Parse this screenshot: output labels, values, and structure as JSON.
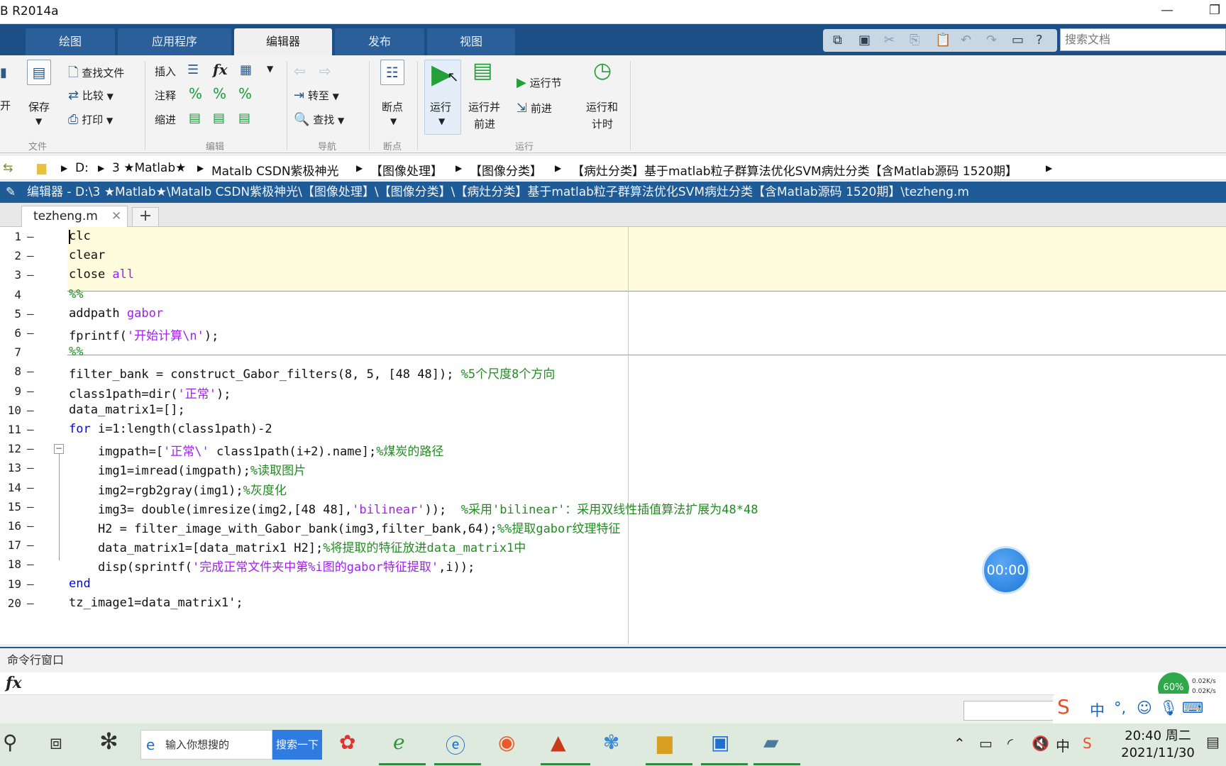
{
  "window": {
    "title": "B R2014a",
    "min": "—",
    "restore": "❐"
  },
  "tabs": [
    {
      "label": "绘图",
      "active": false
    },
    {
      "label": "应用程序",
      "active": false
    },
    {
      "label": "编辑器",
      "active": true
    },
    {
      "label": "发布",
      "active": false
    },
    {
      "label": "视图",
      "active": false
    }
  ],
  "search": {
    "placeholder": "搜索文档"
  },
  "ribbon": {
    "open_label": "开",
    "save_label": "保存",
    "find_files": "查找文件",
    "compare": "比较",
    "print": "打印",
    "insert": "插入",
    "comment": "注释",
    "indent": "缩进",
    "goto": "转至",
    "find": "查找",
    "breakpoints": "断点",
    "run": "运行",
    "run_advance_1": "运行并",
    "run_advance_2": "前进",
    "run_section": "运行节",
    "advance": "前进",
    "run_time_1": "运行和",
    "run_time_2": "计时",
    "groups": {
      "file": "文件",
      "edit": "编辑",
      "nav": "导航",
      "bp": "断点",
      "run": "运行"
    }
  },
  "breadcrumb": [
    "D:",
    "3 ★Matlab★",
    "Matalb CSDN紫极神光",
    "【图像处理】",
    "【图像分类】",
    "【病灶分类】基于matlab粒子群算法优化SVM病灶分类【含Matlab源码 1520期】"
  ],
  "editor": {
    "header": "编辑器 - D:\\3 ★Matlab★\\Matalb CSDN紫极神光\\【图像处理】\\【图像分类】\\【病灶分类】基于matlab粒子群算法优化SVM病灶分类【含Matlab源码 1520期】\\tezheng.m",
    "file_tab": "tezheng.m",
    "add_tab": "+"
  },
  "code": {
    "line_numbers": [
      "1",
      "2",
      "3",
      "4",
      "5",
      "6",
      "7",
      "8",
      "9",
      "10",
      "11",
      "12",
      "13",
      "14",
      "15",
      "16",
      "17",
      "18",
      "19",
      "20"
    ],
    "lines": [
      [
        {
          "t": "clc",
          "c": ""
        }
      ],
      [
        {
          "t": "clear",
          "c": ""
        }
      ],
      [
        {
          "t": "close ",
          "c": ""
        },
        {
          "t": "all",
          "c": "str"
        }
      ],
      [
        {
          "t": "%%",
          "c": "cmt"
        }
      ],
      [
        {
          "t": "addpath ",
          "c": ""
        },
        {
          "t": "gabor",
          "c": "str"
        }
      ],
      [
        {
          "t": "fprintf(",
          "c": ""
        },
        {
          "t": "'开始计算\\n'",
          "c": "str"
        },
        {
          "t": ");",
          "c": ""
        }
      ],
      [
        {
          "t": "%%",
          "c": "cmt"
        }
      ],
      [
        {
          "t": "filter_bank = construct_Gabor_filters(8, 5, [48 48]); ",
          "c": ""
        },
        {
          "t": "%5个尺度8个方向",
          "c": "cmt"
        }
      ],
      [
        {
          "t": "class1path=dir(",
          "c": ""
        },
        {
          "t": "'正常'",
          "c": "str"
        },
        {
          "t": ");",
          "c": ""
        }
      ],
      [
        {
          "t": "data_matrix1=[];",
          "c": ""
        }
      ],
      [
        {
          "t": "for ",
          "c": "kw"
        },
        {
          "t": "i=1:length(class1path)-2",
          "c": ""
        }
      ],
      [
        {
          "t": "    imgpath=[",
          "c": ""
        },
        {
          "t": "'正常\\'",
          "c": "str"
        },
        {
          "t": " class1path(i+2).name];",
          "c": ""
        },
        {
          "t": "%煤炭的路径",
          "c": "cmt"
        }
      ],
      [
        {
          "t": "    img1=imread(imgpath);",
          "c": ""
        },
        {
          "t": "%读取图片",
          "c": "cmt"
        }
      ],
      [
        {
          "t": "    img2=rgb2gray(img1);",
          "c": ""
        },
        {
          "t": "%灰度化",
          "c": "cmt"
        }
      ],
      [
        {
          "t": "    img3= double(imresize(img2,[48 48],",
          "c": ""
        },
        {
          "t": "'bilinear'",
          "c": "str"
        },
        {
          "t": "));  ",
          "c": ""
        },
        {
          "t": "%采用'bilinear'：采用双线性插值算法扩展为48*48",
          "c": "cmt"
        }
      ],
      [
        {
          "t": "    H2 = filter_image_with_Gabor_bank(img3,filter_bank,64);",
          "c": ""
        },
        {
          "t": "%%提取gabor纹理特征",
          "c": "cmt"
        }
      ],
      [
        {
          "t": "    data_matrix1=[data_matrix1 H2];",
          "c": ""
        },
        {
          "t": "%将提取的特征放进data_matrix1中",
          "c": "cmt"
        }
      ],
      [
        {
          "t": "    disp(sprintf(",
          "c": ""
        },
        {
          "t": "'完成正常文件夹中第%i图的gabor特征提取'",
          "c": "str"
        },
        {
          "t": ",i));",
          "c": ""
        }
      ],
      [
        {
          "t": "end",
          "c": "kw"
        }
      ],
      [
        {
          "t": "tz_image1=data_matrix1';",
          "c": ""
        }
      ]
    ]
  },
  "timer": "00:00",
  "command_window": {
    "title": "命令行窗口",
    "fx": "fx"
  },
  "network": {
    "percent": "60%",
    "up": "0.02K/s",
    "down": "0.02K/s"
  },
  "ime": {
    "lang": "中"
  },
  "taskbar": {
    "search_placeholder": "输入你想搜的",
    "search_button": "搜索一下",
    "time": "20:40 周二",
    "date": "2021/11/30",
    "tray_lang": "中"
  },
  "colors": {
    "accent": "#1f5b96",
    "keyword": "#0000ff",
    "string": "#a020f0",
    "comment": "#228b22"
  }
}
